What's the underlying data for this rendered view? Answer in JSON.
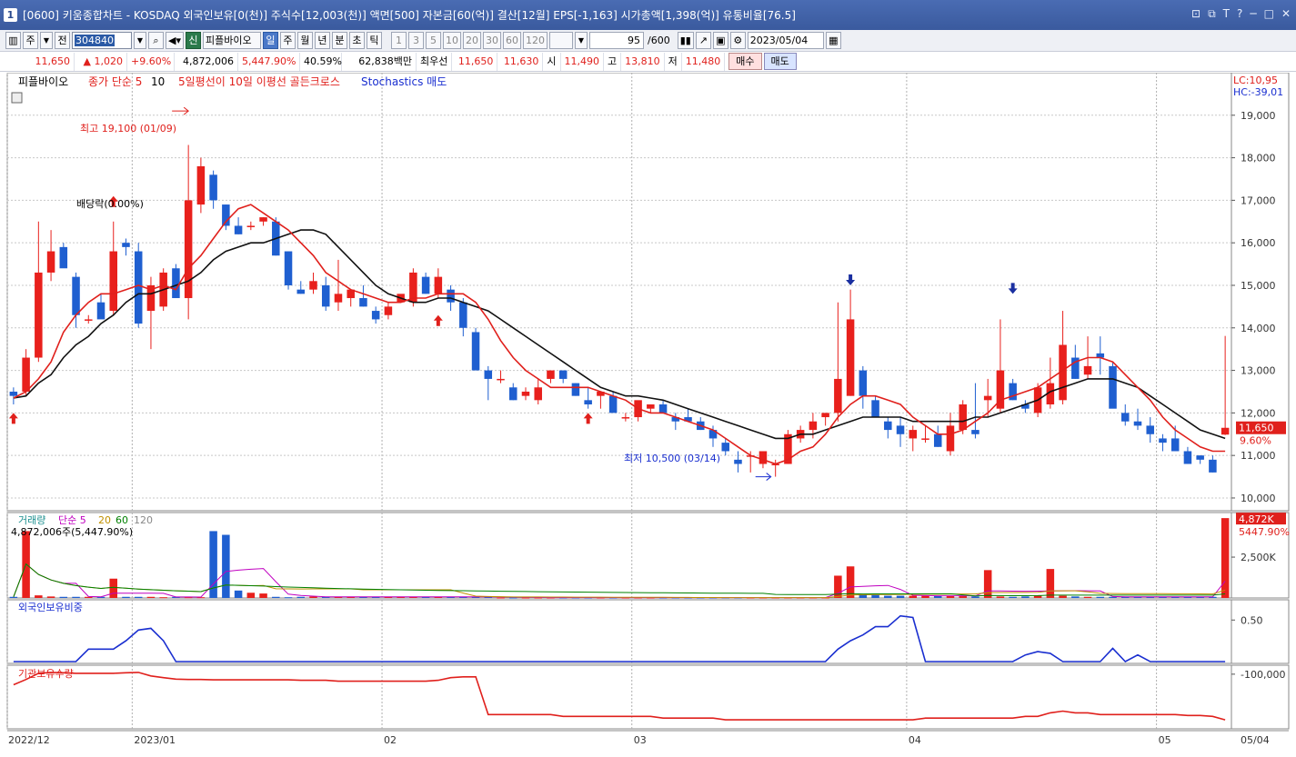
{
  "window": {
    "badge": "1",
    "title": "[0600] 키움종합차트 - KOSDAQ 외국인보유[0(천)] 주식수[12,003(천)] 액면[500] 자본금[60(억)] 결산[12월] EPS[-1,163] 시가총액[1,398(억)] 유통비율[76.5]",
    "buttons": [
      "⊡",
      "⧉",
      "T",
      "?",
      "─",
      "□",
      "✕"
    ]
  },
  "toolbar": {
    "period_main": "주",
    "period_all": "전",
    "code": "304840",
    "company": "피플바이오",
    "new_badge": "신",
    "periods": [
      "일",
      "주",
      "월",
      "년",
      "분",
      "초",
      "틱"
    ],
    "active_period": "일",
    "intervals": [
      "1",
      "3",
      "5",
      "10",
      "20",
      "30",
      "60",
      "120"
    ],
    "count": "95",
    "count_total": "/600",
    "date": "2023/05/04"
  },
  "quote": {
    "price": "11,650",
    "change": "▲ 1,020",
    "pct": "+9.60%",
    "volume": "4,872,006",
    "vol_ratio": "5,447.90%",
    "turnover": "40.59%",
    "amount": "62,838백만",
    "best_label": "최우선",
    "best_ask": "11,650",
    "best_bid": "11,630",
    "open_label": "시",
    "open": "11,490",
    "high_label": "고",
    "high": "13,810",
    "low_label": "저",
    "low": "11,480",
    "buy": "매수",
    "sell": "매도"
  },
  "chart": {
    "legend": {
      "name": "피플바이오",
      "sma_label": "종가 단순 5",
      "sma_val": "10",
      "signal": "5일평선이 10일 이평선 골든크로스",
      "stoch": "Stochastics 매도"
    },
    "annotations": {
      "high": "최고 19,100 (01/09)",
      "low": "최저 10,500 (03/14)",
      "dividend": "배당락(0.00%)"
    },
    "lc": "LC:10,95",
    "hc": "HC:-39,01",
    "price_ticks": [
      "19,000",
      "18,000",
      "17,000",
      "16,000",
      "15,000",
      "14,000",
      "13,000",
      "12,000",
      "11,000",
      "10,000"
    ],
    "last_price_box": "11,650",
    "last_pct": "9.60%",
    "vol_legend": {
      "label": "거래량",
      "sma": "단순 5",
      "p20": "20",
      "p60": "60",
      "p120": "120",
      "value": "4,872,006주(5,447.90%)"
    },
    "vol_box": "4,872K",
    "vol_pct": "5447.90%",
    "vol_tick": "2,500K",
    "foreign_label": "외국인보유비중",
    "foreign_tick": "0.50",
    "inst_label": "기관보유수량",
    "inst_tick": "-100,000",
    "x_labels": [
      "2022/12",
      "2023/01",
      "02",
      "03",
      "04",
      "05",
      "05/04"
    ]
  },
  "chart_data": {
    "type": "candlestick",
    "y_range": [
      9700,
      20000
    ],
    "ohlc": [
      [
        12500,
        12600,
        12200,
        12400
      ],
      [
        12500,
        13500,
        12400,
        13300
      ],
      [
        13300,
        16500,
        13200,
        15300
      ],
      [
        15300,
        16300,
        15100,
        15800
      ],
      [
        15900,
        16000,
        15500,
        15400
      ],
      [
        15200,
        15300,
        14000,
        14300
      ],
      [
        14200,
        14300,
        14100,
        14200
      ],
      [
        14600,
        14800,
        14300,
        14200
      ],
      [
        14400,
        16500,
        14300,
        15800
      ],
      [
        16000,
        16100,
        15700,
        15900
      ],
      [
        15800,
        16000,
        14000,
        14100
      ],
      [
        14400,
        15200,
        13500,
        15000
      ],
      [
        14500,
        15400,
        14400,
        15300
      ],
      [
        15400,
        15500,
        15000,
        14700
      ],
      [
        14700,
        18300,
        14200,
        17000
      ],
      [
        16900,
        18000,
        16700,
        17800
      ],
      [
        17600,
        17700,
        16800,
        17000
      ],
      [
        16900,
        16900,
        16300,
        16400
      ],
      [
        16400,
        16600,
        16200,
        16200
      ],
      [
        16400,
        16500,
        16300,
        16400
      ],
      [
        16500,
        16600,
        16400,
        16600
      ],
      [
        16500,
        16600,
        15700,
        15700
      ],
      [
        15800,
        15800,
        14900,
        15000
      ],
      [
        14900,
        15100,
        14800,
        14800
      ],
      [
        14900,
        15300,
        14800,
        15100
      ],
      [
        15000,
        15200,
        14400,
        14500
      ],
      [
        14600,
        15600,
        14400,
        14800
      ],
      [
        14700,
        14900,
        14500,
        14900
      ],
      [
        14700,
        15000,
        14500,
        14500
      ],
      [
        14400,
        14500,
        14100,
        14200
      ],
      [
        14300,
        14600,
        14200,
        14500
      ],
      [
        14600,
        14700,
        14600,
        14800
      ],
      [
        14600,
        15400,
        14500,
        15300
      ],
      [
        15200,
        15300,
        14800,
        14800
      ],
      [
        14800,
        15400,
        14700,
        15200
      ],
      [
        14900,
        15000,
        14400,
        14600
      ],
      [
        14600,
        14700,
        13800,
        14000
      ],
      [
        13900,
        14000,
        13000,
        13000
      ],
      [
        13000,
        13100,
        12300,
        12800
      ],
      [
        12800,
        13000,
        12700,
        12800
      ],
      [
        12600,
        12700,
        12300,
        12300
      ],
      [
        12400,
        12600,
        12300,
        12500
      ],
      [
        12300,
        12800,
        12200,
        12600
      ],
      [
        12800,
        12900,
        12700,
        13000
      ],
      [
        13000,
        13000,
        12700,
        12800
      ],
      [
        12700,
        12700,
        12400,
        12400
      ],
      [
        12300,
        12600,
        12100,
        12200
      ],
      [
        12400,
        12500,
        12100,
        12500
      ],
      [
        12400,
        12500,
        12200,
        12000
      ],
      [
        11900,
        12000,
        11800,
        11900
      ],
      [
        11900,
        12100,
        11800,
        12300
      ],
      [
        12100,
        12200,
        12000,
        12200
      ],
      [
        12200,
        12300,
        12100,
        12000
      ],
      [
        11900,
        12000,
        11600,
        11800
      ],
      [
        11900,
        12100,
        11800,
        11800
      ],
      [
        11800,
        11900,
        11600,
        11600
      ],
      [
        11600,
        11700,
        11200,
        11400
      ],
      [
        11300,
        11400,
        11000,
        11100
      ],
      [
        10900,
        11100,
        10600,
        10800
      ],
      [
        11000,
        11100,
        10600,
        11000
      ],
      [
        10800,
        11100,
        10700,
        11100
      ],
      [
        10800,
        10900,
        10500,
        10800
      ],
      [
        10800,
        11600,
        10800,
        11500
      ],
      [
        11400,
        11700,
        11300,
        11600
      ],
      [
        11600,
        12000,
        11400,
        11800
      ],
      [
        11900,
        12000,
        11700,
        12000
      ],
      [
        12000,
        14600,
        11800,
        12800
      ],
      [
        12400,
        14900,
        12400,
        14200
      ],
      [
        13000,
        13100,
        12100,
        12400
      ],
      [
        12300,
        12400,
        11900,
        11900
      ],
      [
        11800,
        11900,
        11400,
        11600
      ],
      [
        11700,
        11900,
        11200,
        11500
      ],
      [
        11400,
        11700,
        11100,
        11600
      ],
      [
        11400,
        11700,
        11300,
        11400
      ],
      [
        11500,
        11700,
        11200,
        11200
      ],
      [
        11100,
        12000,
        11000,
        11700
      ],
      [
        11600,
        12300,
        11500,
        12200
      ],
      [
        11600,
        12700,
        11400,
        11500
      ],
      [
        12300,
        12800,
        11900,
        12400
      ],
      [
        12100,
        14200,
        12000,
        13000
      ],
      [
        12700,
        12800,
        12300,
        12300
      ],
      [
        12200,
        12300,
        12000,
        12100
      ],
      [
        12000,
        12700,
        11900,
        12600
      ],
      [
        12200,
        13300,
        12100,
        12700
      ],
      [
        12300,
        14400,
        12200,
        13600
      ],
      [
        13300,
        13600,
        12800,
        12800
      ],
      [
        12900,
        13800,
        12800,
        13100
      ],
      [
        13400,
        13800,
        12900,
        13300
      ],
      [
        13100,
        13200,
        12200,
        12100
      ],
      [
        12000,
        12200,
        11700,
        11800
      ],
      [
        11800,
        12100,
        11600,
        11700
      ],
      [
        11700,
        11900,
        11300,
        11500
      ],
      [
        11400,
        11500,
        11100,
        11300
      ],
      [
        11400,
        11700,
        11100,
        11100
      ],
      [
        11100,
        11200,
        10800,
        10800
      ],
      [
        11000,
        11000,
        10800,
        10900
      ],
      [
        10900,
        11000,
        10600,
        10600
      ],
      [
        11490,
        13810,
        11480,
        11650
      ]
    ],
    "ma5": [
      12350,
      12500,
      12800,
      13200,
      13900,
      14300,
      14600,
      14800,
      14800,
      14900,
      15000,
      14900,
      15000,
      14900,
      15400,
      15700,
      16100,
      16500,
      16800,
      16900,
      16700,
      16500,
      16300,
      16000,
      15700,
      15300,
      15100,
      14900,
      14800,
      14700,
      14600,
      14600,
      14700,
      14700,
      14800,
      14800,
      14800,
      14600,
      14200,
      13700,
      13300,
      13000,
      12800,
      12600,
      12600,
      12600,
      12600,
      12500,
      12400,
      12300,
      12100,
      12000,
      12000,
      11900,
      11800,
      11700,
      11600,
      11400,
      11200,
      11000,
      10900,
      10800,
      10900,
      11100,
      11200,
      11500,
      11900,
      12200,
      12400,
      12400,
      12300,
      12200,
      11900,
      11700,
      11500,
      11500,
      11600,
      11800,
      12000,
      12300,
      12400,
      12500,
      12600,
      12800,
      13000,
      13200,
      13300,
      13300,
      13200,
      12900,
      12600,
      12300,
      11900,
      11600,
      11400,
      11200,
      11100,
      11100
    ],
    "ma10": [
      12350,
      12400,
      12700,
      12900,
      13300,
      13600,
      13800,
      14100,
      14300,
      14600,
      14800,
      14800,
      14900,
      15000,
      15100,
      15300,
      15600,
      15800,
      15900,
      16000,
      16000,
      16100,
      16200,
      16300,
      16300,
      16200,
      15900,
      15600,
      15300,
      15000,
      14800,
      14700,
      14600,
      14600,
      14700,
      14700,
      14600,
      14500,
      14400,
      14200,
      14000,
      13800,
      13600,
      13400,
      13200,
      13000,
      12800,
      12600,
      12500,
      12400,
      12400,
      12350,
      12300,
      12200,
      12100,
      12000,
      11900,
      11800,
      11700,
      11600,
      11500,
      11400,
      11400,
      11500,
      11500,
      11600,
      11700,
      11800,
      11900,
      11900,
      11900,
      11900,
      11800,
      11800,
      11800,
      11800,
      11800,
      11900,
      11900,
      12000,
      12100,
      12200,
      12300,
      12500,
      12600,
      12700,
      12800,
      12800,
      12800,
      12700,
      12600,
      12400,
      12200,
      12000,
      11800,
      11600,
      11500,
      11400
    ],
    "volume": [
      3,
      180,
      7,
      4,
      3,
      3,
      3,
      3,
      52,
      3,
      3,
      3,
      2,
      3,
      2,
      2,
      180,
      170,
      20,
      14,
      12,
      3,
      2,
      3,
      4,
      3,
      3,
      3,
      3,
      3,
      3,
      3,
      3,
      3,
      3,
      3,
      3,
      3,
      3,
      1,
      1,
      1,
      1,
      1,
      1,
      1,
      1,
      1,
      1,
      1,
      1,
      1,
      1,
      1,
      1,
      1,
      1,
      1,
      1,
      1,
      1,
      1,
      1,
      1,
      1,
      1,
      60,
      85,
      10,
      8,
      6,
      6,
      6,
      6,
      5,
      6,
      6,
      4,
      75,
      4,
      3,
      4,
      6,
      78,
      6,
      4,
      3,
      3,
      3,
      3,
      3,
      3,
      3,
      3,
      3,
      3,
      3,
      215
    ],
    "foreign_pct": [
      0,
      0,
      0,
      0,
      0,
      0,
      0.15,
      0.15,
      0.15,
      0.25,
      0.38,
      0.4,
      0.25,
      0,
      0,
      0,
      0,
      0,
      0,
      0,
      0,
      0,
      0,
      0,
      0,
      0,
      0,
      0,
      0,
      0,
      0,
      0,
      0,
      0,
      0,
      0,
      0,
      0,
      0,
      0,
      0,
      0,
      0,
      0,
      0,
      0,
      0,
      0,
      0,
      0,
      0,
      0,
      0,
      0,
      0,
      0,
      0,
      0,
      0,
      0,
      0,
      0,
      0,
      0,
      0,
      0,
      0.15,
      0.25,
      0.32,
      0.42,
      0.42,
      0.55,
      0.53,
      0,
      0,
      0,
      0,
      0,
      0,
      0,
      0,
      0.08,
      0.12,
      0.1,
      0,
      0,
      0,
      0,
      0.16,
      0,
      0.08,
      0,
      0,
      0,
      0,
      0,
      0,
      0
    ],
    "inst_shares": [
      -160000,
      -130000,
      -95000,
      -90000,
      -92000,
      -95000,
      -95000,
      -95000,
      -95000,
      -92000,
      -90000,
      -110000,
      -120000,
      -128000,
      -130000,
      -130000,
      -132000,
      -132000,
      -132000,
      -132000,
      -132000,
      -132000,
      -132000,
      -135000,
      -135000,
      -135000,
      -140000,
      -140000,
      -140000,
      -140000,
      -140000,
      -140000,
      -140000,
      -140000,
      -135000,
      -120000,
      -115000,
      -115000,
      -330000,
      -330000,
      -330000,
      -330000,
      -330000,
      -330000,
      -340000,
      -340000,
      -340000,
      -340000,
      -340000,
      -340000,
      -340000,
      -340000,
      -350000,
      -350000,
      -350000,
      -350000,
      -350000,
      -360000,
      -360000,
      -360000,
      -360000,
      -360000,
      -360000,
      -360000,
      -360000,
      -360000,
      -360000,
      -360000,
      -360000,
      -360000,
      -360000,
      -360000,
      -360000,
      -350000,
      -350000,
      -350000,
      -350000,
      -350000,
      -350000,
      -350000,
      -350000,
      -340000,
      -340000,
      -320000,
      -310000,
      -320000,
      -320000,
      -330000,
      -330000,
      -330000,
      -330000,
      -330000,
      -330000,
      -330000,
      -335000,
      -335000,
      -340000,
      -360000
    ]
  }
}
